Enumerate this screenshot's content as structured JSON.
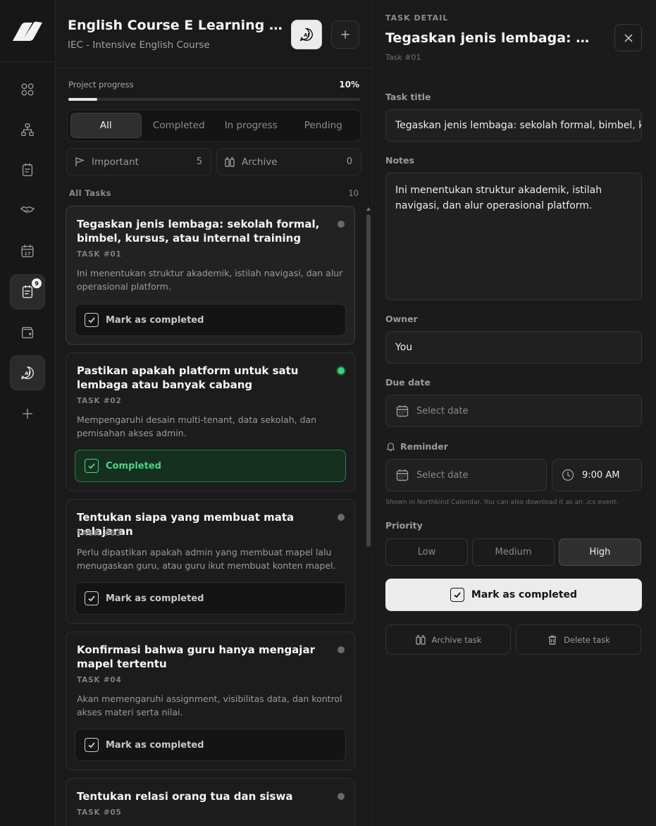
{
  "sidebar": {
    "items": [
      {
        "name": "grid-icon"
      },
      {
        "name": "hierarchy-icon"
      },
      {
        "name": "notes-icon"
      },
      {
        "name": "handshake-icon"
      },
      {
        "name": "calendar-icon",
        "label": "17"
      },
      {
        "name": "tasks-icon",
        "badge": "9",
        "active": true
      },
      {
        "name": "wallet-icon"
      },
      {
        "name": "ai-chat-icon",
        "active": true
      },
      {
        "name": "plus-icon"
      }
    ]
  },
  "project": {
    "title": "English Course E Learning Website",
    "subtitle": "IEC - Intensive English Course",
    "ai_label": "AI",
    "progress_label": "Project progress",
    "progress_text": "10%",
    "progress_value": 0.1
  },
  "filters": {
    "tabs": [
      {
        "label": "All",
        "active": true
      },
      {
        "label": "Completed"
      },
      {
        "label": "In progress"
      },
      {
        "label": "Pending"
      }
    ],
    "important_label": "Important",
    "important_count": "5",
    "archive_label": "Archive",
    "archive_count": "0"
  },
  "tasks_section": {
    "label": "All Tasks",
    "count": "10"
  },
  "tasks": [
    {
      "title": "Tegaskan jenis lembaga: sekolah formal, bimbel, kursus, atau internal training",
      "number": "TASK #01",
      "note": "Ini menentukan struktur akademik, istilah navigasi, dan alur operasional platform.",
      "status": "pending",
      "button": "Mark as completed"
    },
    {
      "title": "Pastikan apakah platform untuk satu lembaga atau banyak cabang",
      "number": "TASK #02",
      "note": "Mempengaruhi desain multi-tenant, data sekolah, dan pemisahan akses admin.",
      "status": "completed",
      "button": "Completed"
    },
    {
      "title": "Tentukan siapa yang membuat mata pelajaran",
      "number": "TASK #03",
      "note": "Perlu dipastikan apakah admin yang membuat mapel lalu menugaskan guru, atau guru ikut membuat konten mapel.",
      "status": "pending",
      "button": "Mark as completed"
    },
    {
      "title": "Konfirmasi bahwa guru hanya mengajar mapel tertentu",
      "number": "TASK #04",
      "note": "Akan memengaruhi assignment, visibilitas data, dan kontrol akses materi serta nilai.",
      "status": "pending",
      "button": "Mark as completed"
    },
    {
      "title": "Tentukan relasi orang tua dan siswa",
      "number": "TASK #05",
      "note": "",
      "status": "pending",
      "button": "Mark as completed"
    }
  ],
  "detail": {
    "kicker": "TASK DETAIL",
    "title": "Tegaskan jenis lembaga: sekolah formal, bimbel, kursus, atau internal training",
    "number": "Task #01",
    "title_label": "Task title",
    "title_value": "Tegaskan jenis lembaga: sekolah formal, bimbel, kursus, atau internal training",
    "notes_label": "Notes",
    "notes_value": "Ini menentukan struktur akademik, istilah navigasi, dan alur operasional platform.",
    "owner_label": "Owner",
    "owner_value": "You",
    "due_label": "Due date",
    "due_placeholder": "Select date",
    "reminder_label": "Reminder",
    "reminder_placeholder": "Select date",
    "reminder_time": "9:00 AM",
    "helper_text": "Shown in Northkind Calendar. You can also download it as an .ics event.",
    "priority_label": "Priority",
    "priorities": [
      {
        "label": "Low"
      },
      {
        "label": "Medium"
      },
      {
        "label": "High",
        "active": true
      }
    ],
    "complete_label": "Mark as completed",
    "archive_label": "Archive task",
    "delete_label": "Delete task"
  }
}
